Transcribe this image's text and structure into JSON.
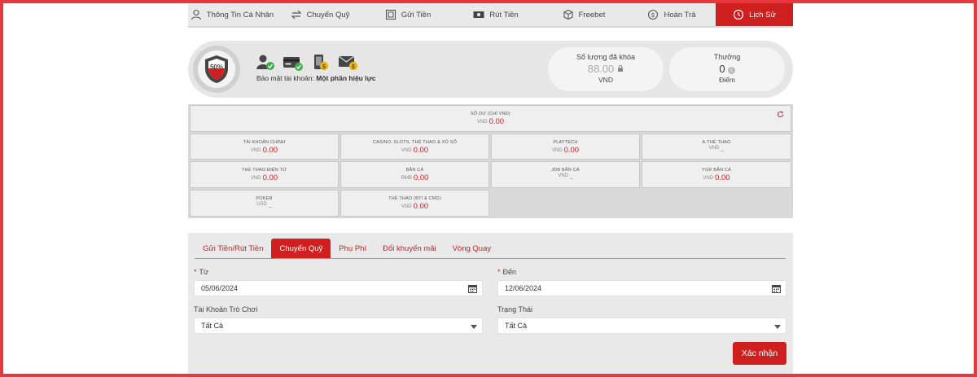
{
  "nav": {
    "items": [
      {
        "label": "Thông Tin Cá Nhân",
        "icon": "user-icon"
      },
      {
        "label": "Chuyển Quỹ",
        "icon": "transfer-icon"
      },
      {
        "label": "Gửi Tiền",
        "icon": "deposit-icon"
      },
      {
        "label": "Rút Tiền",
        "icon": "withdraw-icon"
      },
      {
        "label": "Freebet",
        "icon": "freebet-icon"
      },
      {
        "label": "Hoàn Trả",
        "icon": "rebate-icon"
      },
      {
        "label": "Lịch Sử",
        "icon": "history-icon",
        "active": true
      }
    ]
  },
  "account": {
    "security_percent": "50%",
    "security_label": "Bảo mật tài khoản:",
    "security_status": "Một phần hiệu lực",
    "locked": {
      "title": "Số lượng đã khóa",
      "value": "88.00",
      "unit": "VND"
    },
    "bonus": {
      "title": "Thưởng",
      "value": "0",
      "unit": "Điểm"
    }
  },
  "balance": {
    "total": {
      "label": "SỐ DƯ (CHỈ VND)",
      "currency": "VND",
      "value": "0.00"
    },
    "cells": [
      {
        "label": "TÀI KHOẢN CHÍNH",
        "currency": "VND",
        "value": "0.00"
      },
      {
        "label": "CASINO, SLOTS, THỂ THAO & XỔ SỐ",
        "currency": "VND",
        "value": "0.00"
      },
      {
        "label": "PLAYTECH",
        "currency": "VND",
        "value": "0.00"
      },
      {
        "label": "A-THỂ THAO",
        "currency": "VND",
        "value": "_"
      },
      {
        "label": "THỂ THAO ĐIỆN TỬ",
        "currency": "VND",
        "value": "0.00"
      },
      {
        "label": "BẮN CÁ",
        "currency": "RMB",
        "value": "0.00"
      },
      {
        "label": "JDB BẮN CÁ",
        "currency": "VND",
        "value": "_"
      },
      {
        "label": "YGR BẮN CÁ",
        "currency": "VND",
        "value": "0.00"
      },
      {
        "label": "POKER",
        "currency": "USD",
        "value": "_"
      },
      {
        "label": "THỂ THAO (BTI & CMD)",
        "currency": "VND",
        "value": "0.00"
      }
    ]
  },
  "history": {
    "tabs": [
      "Gửi Tiền/Rút Tiền",
      "Chuyển Quỹ",
      "Phụ Phí",
      "Đổi khuyến mãi",
      "Vòng Quay"
    ],
    "active_tab": "Chuyển Quỹ",
    "from_label": "Từ",
    "from_value": "05/06/2024",
    "to_label": "Đến",
    "to_value": "12/06/2024",
    "game_account_label": "Tài Khoản Trò Chơi",
    "game_account_value": "Tất Cả",
    "status_label": "Trạng Thái",
    "status_value": "Tất Cả",
    "confirm_label": "Xác nhận"
  },
  "colors": {
    "accent": "#cf1f1f",
    "border": "#e8383d",
    "panel": "#e9e9e9"
  }
}
